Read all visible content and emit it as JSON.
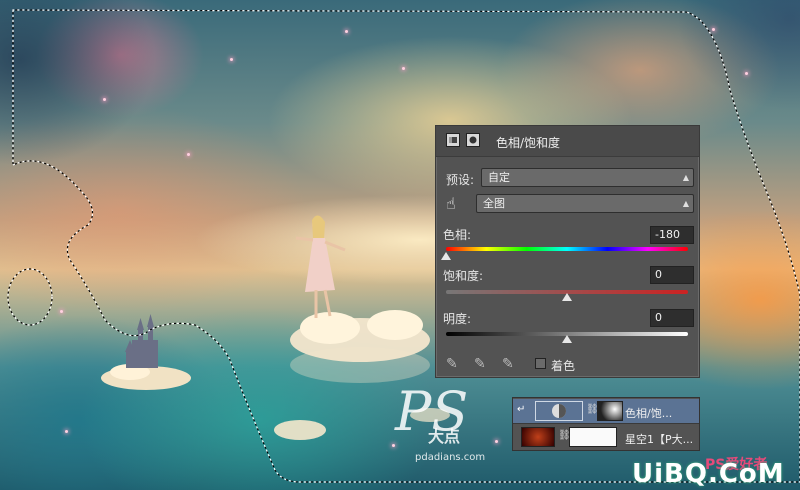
{
  "adjustment_panel": {
    "title": "色相/饱和度",
    "preset_label": "预设:",
    "preset_value": "自定",
    "channel_value": "全图",
    "hue_label": "色相:",
    "hue_value": "-180",
    "saturation_label": "饱和度:",
    "saturation_value": "0",
    "lightness_label": "明度:",
    "lightness_value": "0",
    "colorize_label": "着色",
    "colorize_checked": false,
    "hue_level": 0.0,
    "saturation_level": 0.5,
    "lightness_level": 0.5
  },
  "layers": [
    {
      "name": "色相/饱...",
      "selected": true
    },
    {
      "name": "星空1【P大...",
      "selected": false
    }
  ],
  "watermarks": {
    "ps_logo": "PS",
    "ps_sub": "大点",
    "site": "pdadians.com",
    "corner_brand": "UiBQ.CoM",
    "corner_ps": "PS爱好者"
  },
  "icons": {
    "panel_adjust": "adjustment-layer-icon",
    "panel_mask": "mask-icon",
    "hand": "targeted-adjustment-hand-icon",
    "eyedroppers": [
      "eyedropper-icon",
      "eyedropper-plus-icon",
      "eyedropper-minus-icon"
    ]
  }
}
